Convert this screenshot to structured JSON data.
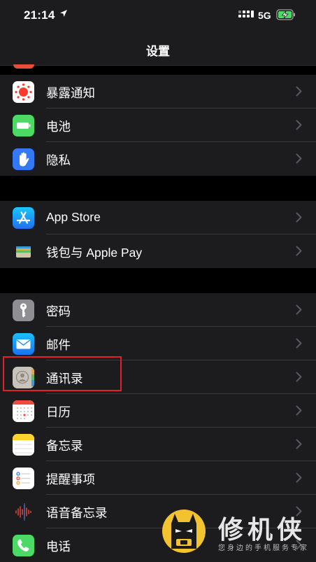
{
  "status": {
    "time": "21:14",
    "network": "5G"
  },
  "nav": {
    "title": "设置"
  },
  "groups": [
    {
      "items": [
        {
          "label": "暴露通知",
          "icon": "exposure-notification-icon"
        },
        {
          "label": "电池",
          "icon": "battery-icon"
        },
        {
          "label": "隐私",
          "icon": "privacy-hand-icon"
        }
      ]
    },
    {
      "items": [
        {
          "label": "App Store",
          "icon": "app-store-icon"
        },
        {
          "label": "钱包与 Apple Pay",
          "icon": "wallet-icon"
        }
      ]
    },
    {
      "items": [
        {
          "label": "密码",
          "icon": "key-icon"
        },
        {
          "label": "邮件",
          "icon": "mail-icon"
        },
        {
          "label": "通讯录",
          "icon": "contacts-icon"
        },
        {
          "label": "日历",
          "icon": "calendar-icon"
        },
        {
          "label": "备忘录",
          "icon": "notes-icon"
        },
        {
          "label": "提醒事项",
          "icon": "reminders-icon"
        },
        {
          "label": "语音备忘录",
          "icon": "voice-memos-icon"
        },
        {
          "label": "电话",
          "icon": "phone-icon"
        }
      ]
    }
  ],
  "watermark": {
    "title": "修机侠",
    "subtitle": "您身边的手机服务专家"
  },
  "colors": {
    "highlight": "#e0202c",
    "cell_bg": "#1c1c1e",
    "separator": "#38383a"
  }
}
